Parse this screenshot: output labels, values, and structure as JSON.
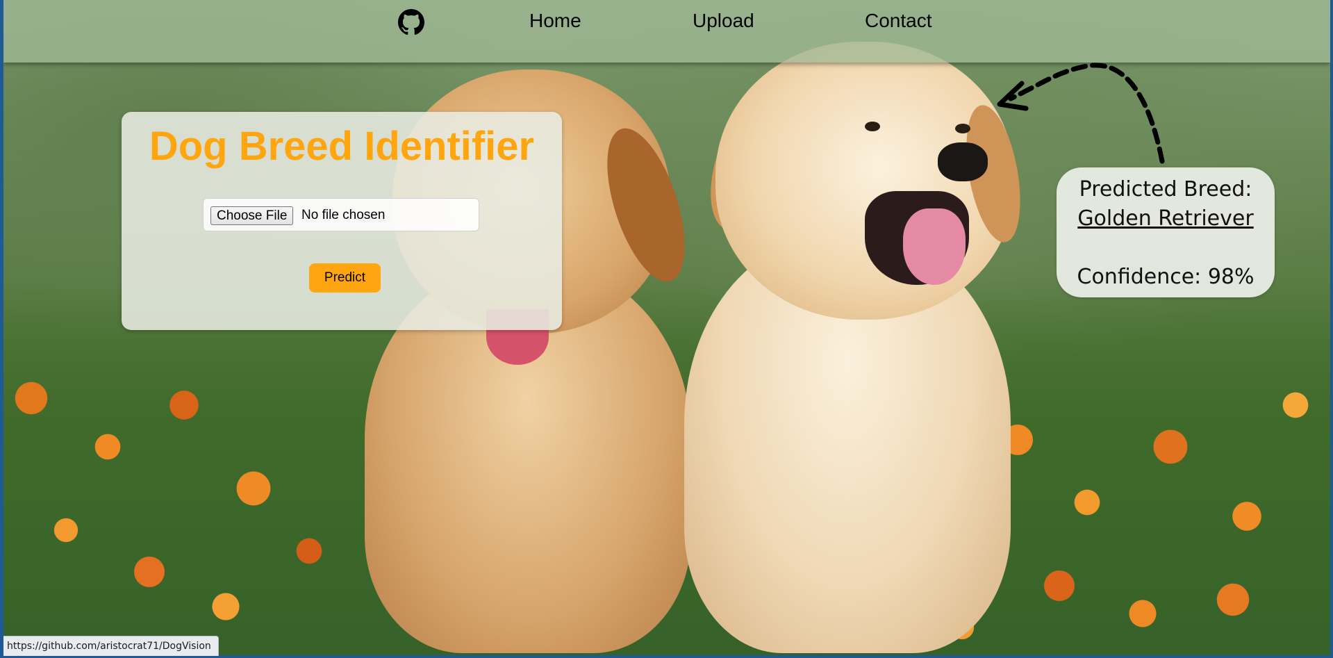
{
  "nav": {
    "github_icon": "github-icon",
    "home_label": "Home",
    "upload_label": "Upload",
    "contact_label": "Contact"
  },
  "card": {
    "title": "Dog Breed Identifier",
    "choose_file_label": "Choose File",
    "file_status": "No file chosen",
    "predict_label": "Predict"
  },
  "result": {
    "breed_label": "Predicted Breed:",
    "breed_value": "Golden Retriever",
    "confidence_text": "Confidence: 98%"
  },
  "status_bar": {
    "url": "https://github.com/aristocrat71/DogVision"
  },
  "colors": {
    "accent": "#ffa50f",
    "window_frame": "#1f5a94"
  }
}
